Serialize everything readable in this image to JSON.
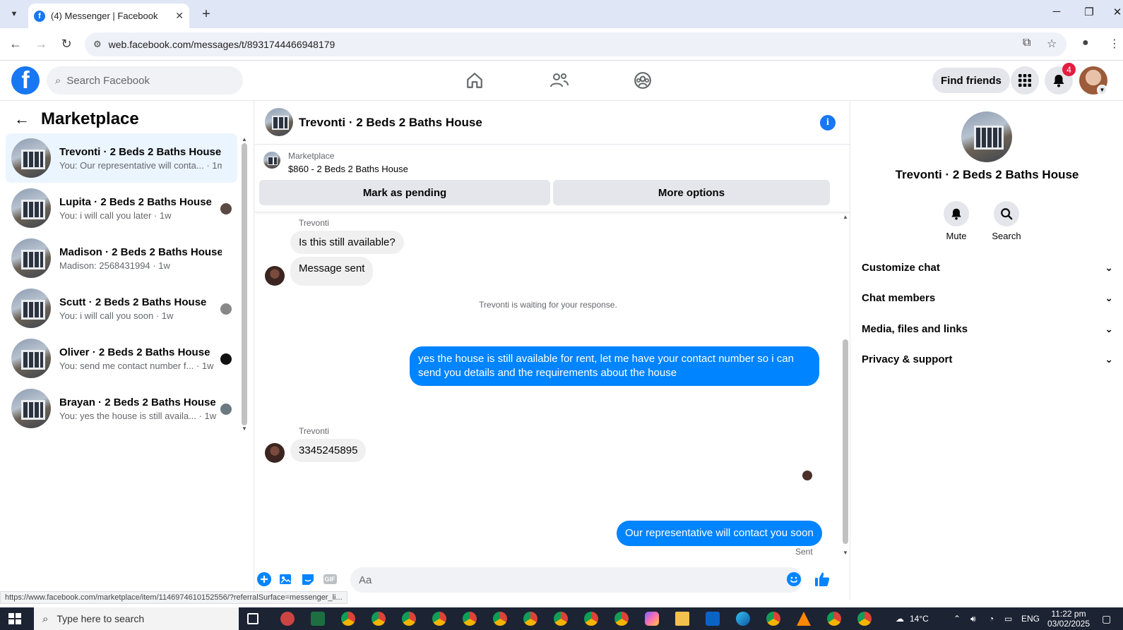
{
  "browser": {
    "tab_title": "(4) Messenger | Facebook",
    "favicon_letter": "f",
    "url": "web.facebook.com/messages/t/8931744466948179",
    "status_url": "https://www.facebook.com/marketplace/item/1146974610152556/?referralSurface=messenger_li..."
  },
  "header": {
    "logo_letter": "f",
    "search_placeholder": "Search Facebook",
    "find_friends": "Find friends",
    "notification_count": "4"
  },
  "sidebar": {
    "title": "Marketplace",
    "conversations": [
      {
        "name": "Trevonti · 2 Beds 2 Baths House",
        "preview": "You: Our representative will conta... · 1m",
        "active": true
      },
      {
        "name": "Lupita · 2 Beds 2 Baths House",
        "preview": "You: i will call you later · 1w"
      },
      {
        "name": "Madison · 2 Beds 2 Baths House",
        "preview": "Madison: 2568431994 · 1w"
      },
      {
        "name": "Scutt · 2 Beds 2 Baths House",
        "preview": "You: i will call you soon · 1w"
      },
      {
        "name": "Oliver · 2 Beds 2 Baths House",
        "preview": "You: send me contact number f... · 1w"
      },
      {
        "name": "Brayan · 2 Beds 2 Baths House",
        "preview": "You: yes the house is still availa... · 1w"
      }
    ]
  },
  "chat": {
    "title": "Trevonti · 2 Beds 2 Baths House",
    "listing": {
      "category": "Marketplace",
      "price_title": "$860 - 2 Beds 2 Baths House",
      "mark_pending": "Mark as pending",
      "more_options": "More options"
    },
    "messages": {
      "sender1": "Trevonti",
      "in1": "Is this still available?",
      "in2": "Message sent",
      "system": "Trevonti is waiting for your response.",
      "out1": "yes the house is still available for rent, let me have your contact number so i can send you details and the requirements about the house",
      "sender2": "Trevonti",
      "in3": "3345245895",
      "out2": "Our representative will contact you soon",
      "sent_label": "Sent"
    },
    "composer_placeholder": "Aa",
    "gif_label": "GIF"
  },
  "details": {
    "title": "Trevonti · 2 Beds 2 Baths House",
    "mute": "Mute",
    "search": "Search",
    "sections": [
      "Customize chat",
      "Chat members",
      "Media, files and links",
      "Privacy & support"
    ]
  },
  "taskbar": {
    "search_placeholder": "Type here to search",
    "weather": "14°C",
    "language": "ENG",
    "time": "11:22 pm",
    "date": "03/02/2025"
  },
  "colors": {
    "brand": "#1877f2",
    "messenger_blue": "#0084ff",
    "badge": "#e41e3f"
  }
}
